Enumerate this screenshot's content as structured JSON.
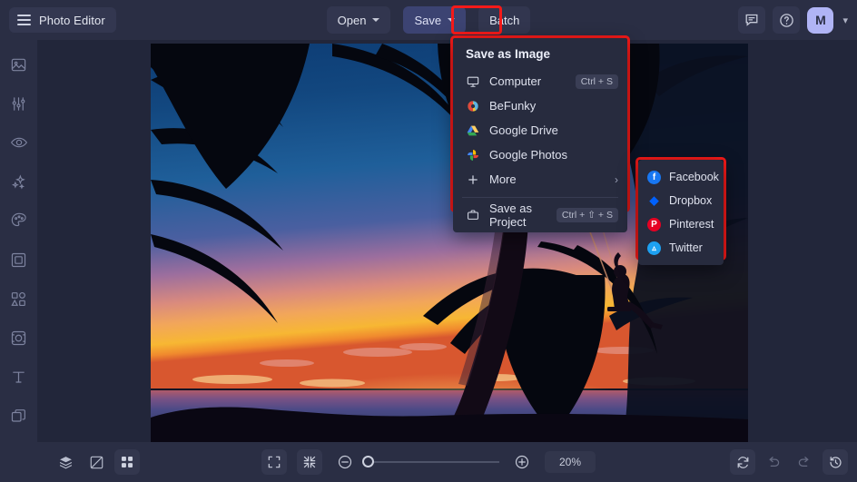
{
  "app": {
    "title": "Photo Editor",
    "menu_icon": "hamburger-icon"
  },
  "colors": {
    "topbar_bg": "#2a2e44",
    "canvas_bg": "#22263a",
    "menu_bg": "#272b3e",
    "highlight_red": "#f51a19",
    "save_button_bg": "#3c4372",
    "avatar_bg": "#b0b4f5"
  },
  "toolbar": {
    "open_label": "Open",
    "save_label": "Save",
    "batch_label": "Batch",
    "feedback_icon": "speech-bubble-icon",
    "help_icon": "question-circle-icon",
    "avatar_initial": "M",
    "avatar_caret_icon": "chevron-down-icon"
  },
  "sidebar": {
    "items": [
      {
        "name": "sidebar-item-image",
        "icon": "image-icon"
      },
      {
        "name": "sidebar-item-edit",
        "icon": "sliders-icon"
      },
      {
        "name": "sidebar-item-retouch",
        "icon": "eye-icon"
      },
      {
        "name": "sidebar-item-effects",
        "icon": "sparkles-icon"
      },
      {
        "name": "sidebar-item-artsy",
        "icon": "palette-icon"
      },
      {
        "name": "sidebar-item-frames",
        "icon": "frame-icon"
      },
      {
        "name": "sidebar-item-graphics",
        "icon": "shapes-icon"
      },
      {
        "name": "sidebar-item-overlays",
        "icon": "overlay-icon"
      },
      {
        "name": "sidebar-item-text",
        "icon": "text-icon"
      },
      {
        "name": "sidebar-item-layers",
        "icon": "layers-copy-icon"
      }
    ]
  },
  "save_menu": {
    "title": "Save as Image",
    "items": [
      {
        "label": "Computer",
        "icon": "monitor-icon",
        "shortcut": "Ctrl + S"
      },
      {
        "label": "BeFunky",
        "icon": "befunky-icon",
        "shortcut": ""
      },
      {
        "label": "Google Drive",
        "icon": "google-drive-icon",
        "shortcut": ""
      },
      {
        "label": "Google Photos",
        "icon": "google-photos-icon",
        "shortcut": ""
      },
      {
        "label": "More",
        "icon": "plus-icon",
        "shortcut": ""
      }
    ],
    "more_chevron_icon": "chevron-right-icon",
    "project": {
      "label": "Save as Project",
      "icon": "briefcase-icon",
      "shortcut": "Ctrl + ⇧ + S"
    }
  },
  "more_submenu": {
    "items": [
      {
        "label": "Facebook",
        "icon": "facebook-icon",
        "color": "#1877f2",
        "glyph": "f"
      },
      {
        "label": "Dropbox",
        "icon": "dropbox-icon",
        "color": "#0061fe",
        "glyph": "▼"
      },
      {
        "label": "Pinterest",
        "icon": "pinterest-icon",
        "color": "#e60023",
        "glyph": "P"
      },
      {
        "label": "Twitter",
        "icon": "twitter-icon",
        "color": "#1da1f2",
        "glyph": "t"
      }
    ]
  },
  "bottombar": {
    "left_tools": [
      {
        "name": "layers-button",
        "icon": "layers-stack-icon",
        "active": false
      },
      {
        "name": "compare-button",
        "icon": "compare-icon",
        "active": false
      },
      {
        "name": "grid-button",
        "icon": "grid-icon",
        "active": true
      }
    ],
    "fit_screen_icon": "fit-screen-icon",
    "actual_size_icon": "shrink-icon",
    "zoom_out_icon": "minus-circle-icon",
    "zoom_in_icon": "plus-circle-icon",
    "zoom_value": "20%",
    "zoom_slider_percent": 0,
    "right_tools": [
      {
        "name": "reset-button",
        "icon": "refresh-icon",
        "enabled": true
      },
      {
        "name": "undo-button",
        "icon": "undo-icon",
        "enabled": false
      },
      {
        "name": "redo-button",
        "icon": "redo-icon",
        "enabled": false
      },
      {
        "name": "history-button",
        "icon": "history-icon",
        "enabled": true
      }
    ]
  },
  "canvas": {
    "photo_alt": "Tropical sunset with palm tree silhouettes and a person on a beach swing"
  }
}
